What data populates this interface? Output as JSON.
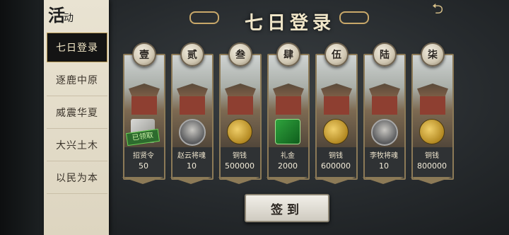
{
  "sidebar": {
    "title_big": "活",
    "title_small": "动",
    "items": [
      {
        "label": "七日登录",
        "active": true
      },
      {
        "label": "逐鹿中原",
        "active": false
      },
      {
        "label": "威震华夏",
        "active": false
      },
      {
        "label": "大兴土木",
        "active": false
      },
      {
        "label": "以民为本",
        "active": false
      }
    ]
  },
  "header": {
    "title": "七日登录",
    "back_icon": "back-arrow-icon"
  },
  "days": [
    {
      "day": "壹",
      "reward": "招贤令",
      "qty": "50",
      "icon": "order",
      "claimed": true,
      "claimed_label": "已领取"
    },
    {
      "day": "贰",
      "reward": "赵云将魂",
      "qty": "10",
      "icon": "portrait"
    },
    {
      "day": "叁",
      "reward": "铜钱",
      "qty": "500000",
      "icon": "coin-stack"
    },
    {
      "day": "肆",
      "reward": "礼金",
      "qty": "2000",
      "icon": "jade"
    },
    {
      "day": "伍",
      "reward": "铜钱",
      "qty": "600000",
      "icon": "coin-stack"
    },
    {
      "day": "陆",
      "reward": "李牧将魂",
      "qty": "10",
      "icon": "portrait"
    },
    {
      "day": "柒",
      "reward": "铜钱",
      "qty": "800000",
      "icon": "coin-stack"
    }
  ],
  "sign_button": "签到"
}
